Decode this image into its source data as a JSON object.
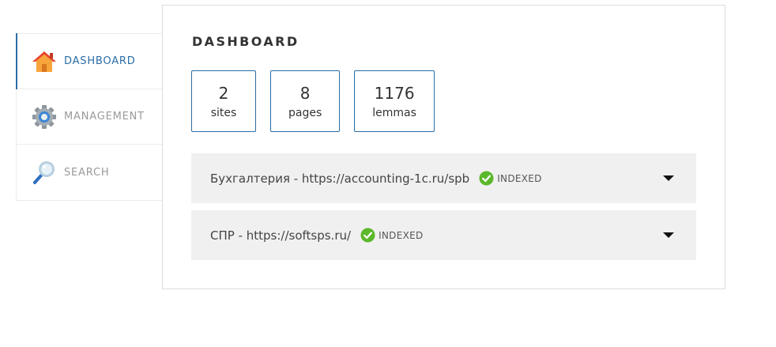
{
  "sidebar": {
    "items": [
      {
        "label": "DASHBOARD",
        "icon": "home-icon",
        "active": true
      },
      {
        "label": "MANAGEMENT",
        "icon": "gear-icon",
        "active": false
      },
      {
        "label": "SEARCH",
        "icon": "magnifier-icon",
        "active": false
      }
    ]
  },
  "main": {
    "title": "DASHBOARD",
    "stats": [
      {
        "value": "2",
        "label": "sites"
      },
      {
        "value": "8",
        "label": "pages"
      },
      {
        "value": "1176",
        "label": "lemmas"
      }
    ],
    "sites": [
      {
        "name": "Бухгалтерия - https://accounting-1c.ru/spb",
        "status": "INDEXED"
      },
      {
        "name": "СПР - https://softsps.ru/",
        "status": "INDEXED"
      }
    ]
  },
  "colors": {
    "accent": "#2a6ea6",
    "status_ok": "#5cb82b",
    "row_bg": "#f0f0f0"
  }
}
